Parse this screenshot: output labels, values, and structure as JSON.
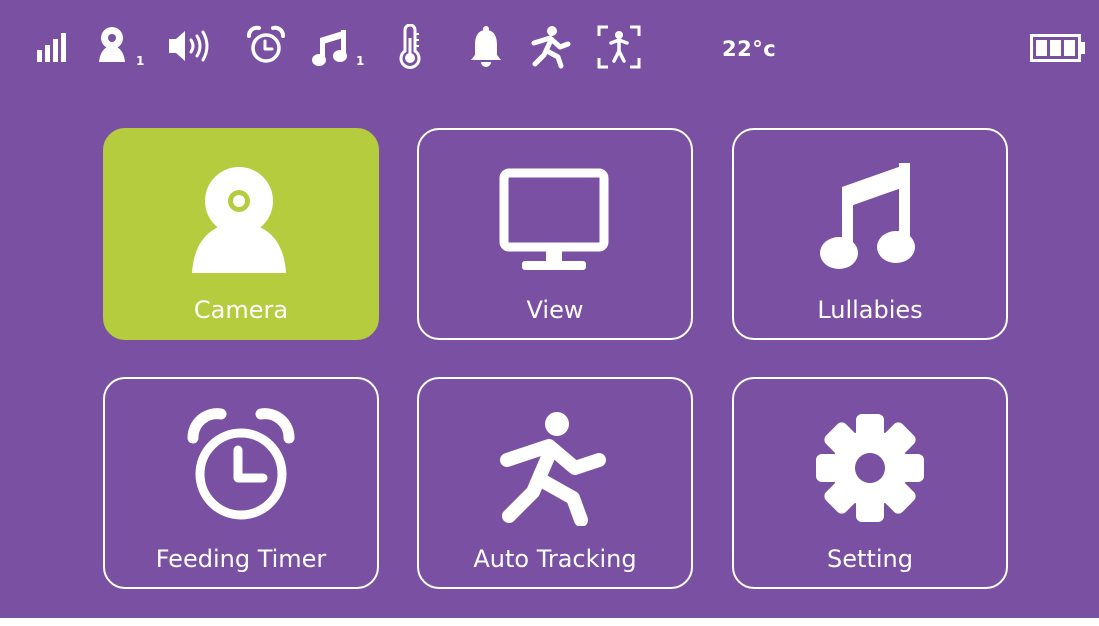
{
  "status_bar": {
    "icons": [
      {
        "icon": "signal-strength-icon"
      },
      {
        "icon": "camera-icon",
        "subscript": "1"
      },
      {
        "icon": "speaker-volume-icon"
      },
      {
        "icon": "alarm-clock-icon"
      },
      {
        "icon": "music-note-icon",
        "subscript": "1"
      },
      {
        "icon": "thermometer-icon"
      },
      {
        "icon": "bell-icon"
      },
      {
        "icon": "running-person-icon"
      },
      {
        "icon": "person-tracking-icon"
      }
    ],
    "temperature": "22°c",
    "battery_icon": "battery-full-icon"
  },
  "menu": {
    "tiles": [
      {
        "label": "Camera",
        "icon": "camera-icon",
        "selected": true
      },
      {
        "label": "View",
        "icon": "monitor-icon",
        "selected": false
      },
      {
        "label": "Lullabies",
        "icon": "music-note-icon",
        "selected": false
      },
      {
        "label": "Feeding Timer",
        "icon": "alarm-clock-icon",
        "selected": false
      },
      {
        "label": "Auto Tracking",
        "icon": "running-person-icon",
        "selected": false
      },
      {
        "label": "Setting",
        "icon": "gear-icon",
        "selected": false
      }
    ]
  },
  "colors": {
    "background": "#7a50a2",
    "selected_tile": "#b5cc3f",
    "foreground": "#ffffff"
  }
}
